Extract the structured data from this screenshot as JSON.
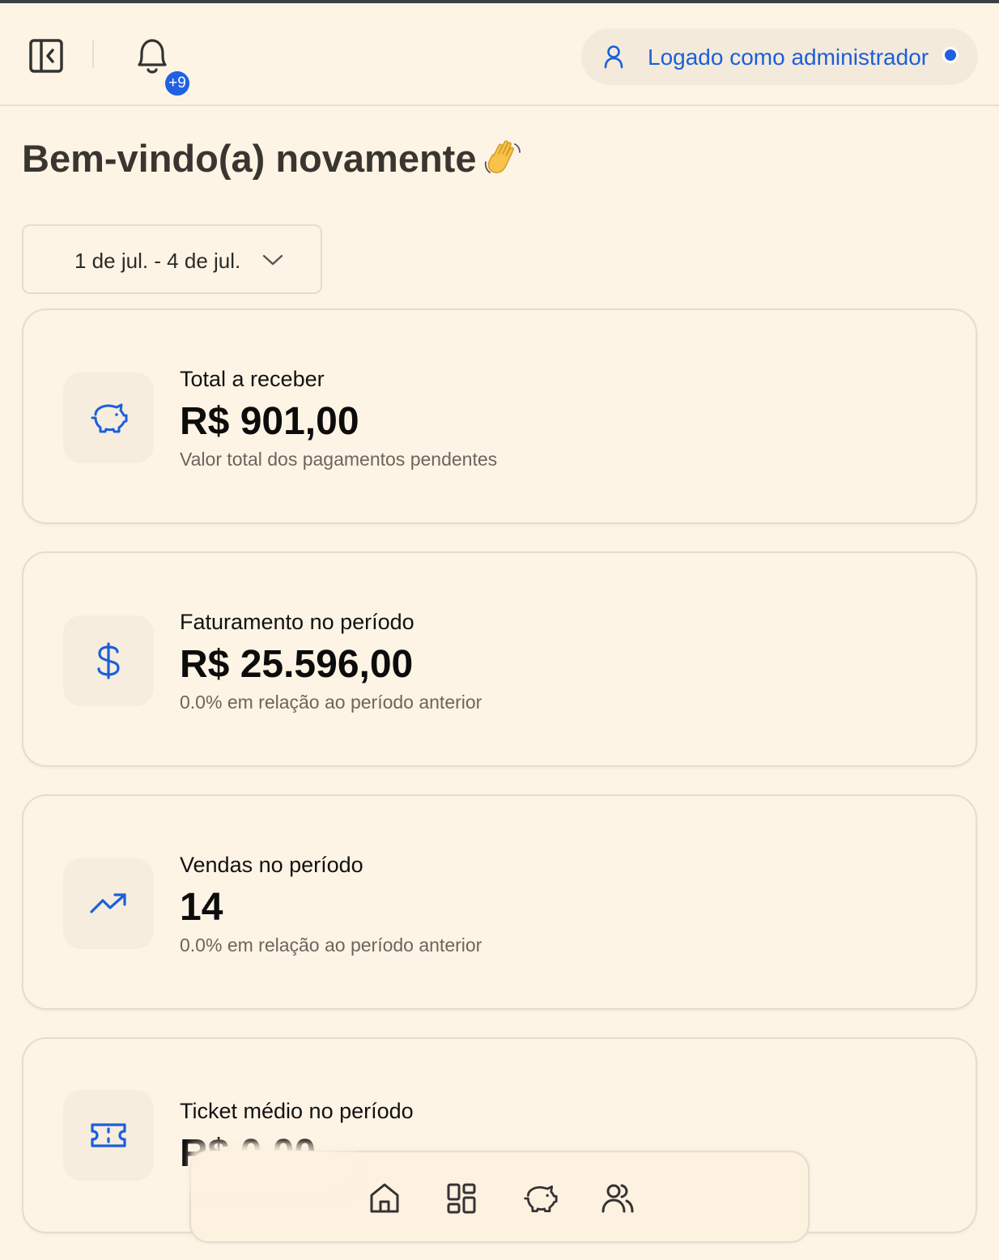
{
  "header": {
    "notifications_badge": "+9",
    "user_label": "Logado como administrador"
  },
  "welcome": {
    "title": "Bem-vindo(a) novamente",
    "emoji_icon": "waving-hand-icon"
  },
  "date_range": {
    "label": "1 de jul. - 4 de jul."
  },
  "cards": [
    {
      "icon": "piggy-bank-icon",
      "title": "Total a receber",
      "value": "R$ 901,00",
      "subtitle": "Valor total dos pagamentos pendentes"
    },
    {
      "icon": "dollar-icon",
      "title": "Faturamento no período",
      "value": "R$ 25.596,00",
      "subtitle": "0.0% em relação ao período anterior"
    },
    {
      "icon": "trending-up-icon",
      "title": "Vendas no período",
      "value": "14",
      "subtitle": "0.0% em relação ao período anterior"
    },
    {
      "icon": "ticket-icon",
      "title": "Ticket médio no período",
      "value": "R$ 0,00",
      "subtitle": ""
    }
  ],
  "bottom_nav": {
    "items": [
      "home-icon",
      "dashboard-icon",
      "piggy-bank-icon",
      "users-icon"
    ]
  },
  "colors": {
    "background": "#fef4e5",
    "accent": "#1f61e2",
    "border": "#e6dccd"
  }
}
